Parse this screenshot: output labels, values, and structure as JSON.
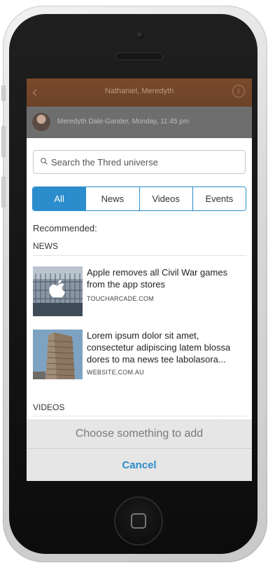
{
  "header": {
    "title": "Nathaniel, Meredyth",
    "subtitle": "Meredyth Dale-Gander, Monday, 11:45 pm"
  },
  "search": {
    "placeholder": "Search the Thred universe"
  },
  "tabs": [
    {
      "label": "All",
      "active": true
    },
    {
      "label": "News",
      "active": false
    },
    {
      "label": "Videos",
      "active": false
    },
    {
      "label": "Events",
      "active": false
    }
  ],
  "content": {
    "recommended_label": "Recommended:",
    "news_section": "NEWS",
    "videos_section": "VIDEOS",
    "items": [
      {
        "title": "Apple removes all Civil War games from the app stores",
        "source": "TOUCHARCADE.COM",
        "thumb_icon": "apple-store-photo"
      },
      {
        "title": "Lorem ipsum dolor sit amet, consectetur adipiscing latem blossa dores to ma news tee labolasora...",
        "source": "WEBSITE.COM.AU",
        "thumb_icon": "building-photo"
      }
    ]
  },
  "actions": {
    "prompt": "Choose something to add",
    "cancel": "Cancel"
  },
  "colors": {
    "accent": "#2c8dcd",
    "header_bg": "#7a4a2a"
  }
}
